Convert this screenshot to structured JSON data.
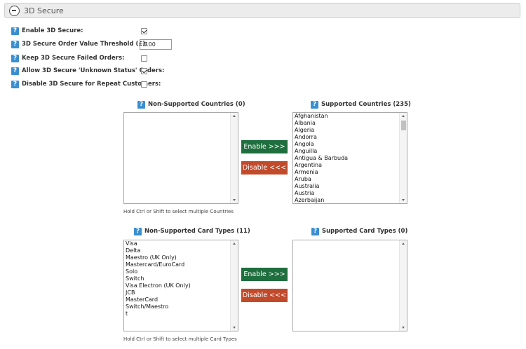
{
  "panel": {
    "title": "3D Secure",
    "collapse_icon": "minus-circle-icon"
  },
  "help_icon_glyph": "?",
  "settings": {
    "enable": {
      "label": "Enable 3D Secure:",
      "checked": true
    },
    "threshold": {
      "label": "3D Secure Order Value Threshold (£):",
      "value": "0.00"
    },
    "keep_failed": {
      "label": "Keep 3D Secure Failed Orders:",
      "checked": false
    },
    "allow_unknown": {
      "label": "Allow 3D Secure 'Unknown Status' Orders:",
      "checked": true
    },
    "disable_repeat": {
      "label": "Disable 3D Secure for Repeat Customers:",
      "checked": false
    }
  },
  "countries": {
    "non_supported_label": "Non-Supported Countries (0)",
    "supported_label": "Supported Countries (235)",
    "supported_items": [
      "Afghanistan",
      "Albania",
      "Algeria",
      "Andorra",
      "Angola",
      "Anguilla",
      "Antigua & Barbuda",
      "Argentina",
      "Armenia",
      "Aruba",
      "Australia",
      "Austria",
      "Azerbaijan"
    ],
    "enable_label": "Enable >>>",
    "disable_label": "Disable <<<",
    "hint": "Hold Ctrl or Shift to select multiple Countries"
  },
  "cards": {
    "non_supported_label": "Non-Supported Card Types (11)",
    "supported_label": "Supported Card Types (0)",
    "non_supported_items": [
      "Visa",
      "Delta",
      "Maestro (UK Only)",
      "Mastercard/EuroCard",
      "Solo",
      "Switch",
      "Visa Electron (UK Only)",
      "JCB",
      "MasterCard",
      "Switch/Maestro",
      "t"
    ],
    "enable_label": "Enable >>>",
    "disable_label": "Disable <<<",
    "hint": "Hold Ctrl or Shift to select multiple Card Types"
  },
  "colors": {
    "enable_button": "#1f6e3e",
    "disable_button": "#c14a2b",
    "help_icon": "#3a8fd0"
  }
}
